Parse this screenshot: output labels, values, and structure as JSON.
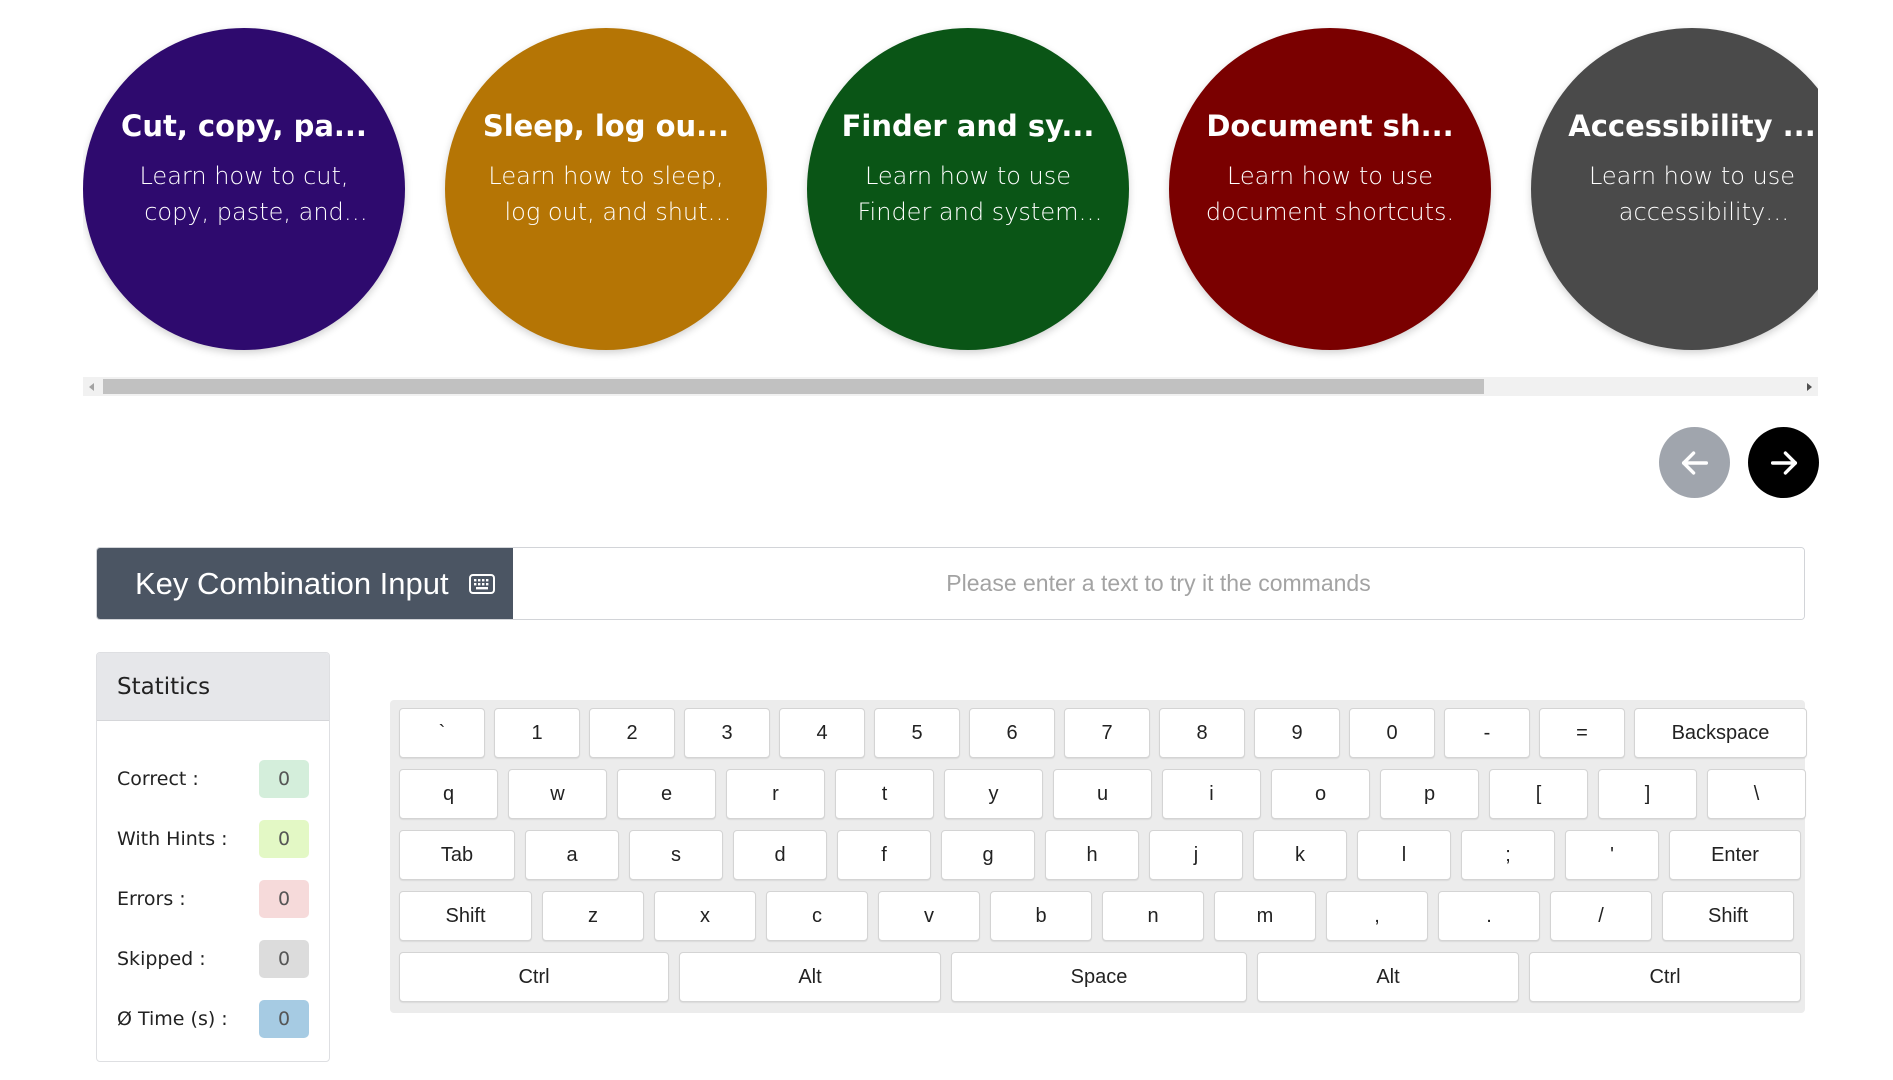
{
  "carousel": {
    "cards": [
      {
        "title": "Cut, copy, pa...",
        "description": "Learn how to cut, copy, paste, and other...",
        "color": "#2e0a6e"
      },
      {
        "title": "Sleep, log ou...",
        "description": "Learn how to sleep, log out, and shut down yo...",
        "color": "#b57505"
      },
      {
        "title": "Finder and sy...",
        "description": "Learn how to use Finder and system shortcuts.",
        "color": "#0a5516"
      },
      {
        "title": "Document sh...",
        "description": "Learn how to use document shortcuts.",
        "color": "#7a0000"
      },
      {
        "title": "Accessibility ...",
        "description": "Learn how to use accessibility shortcuts.",
        "color": "#4a4a4a"
      }
    ],
    "prev_icon": "arrow-left-icon",
    "next_icon": "arrow-right-icon"
  },
  "input": {
    "label": "Key Combination Input",
    "icon": "keyboard-icon",
    "placeholder": "Please enter a text to try it the commands",
    "value": ""
  },
  "stats": {
    "title": "Statitics",
    "rows": [
      {
        "label": "Correct :",
        "value": "0",
        "color": "#d4eedb"
      },
      {
        "label": "With Hints :",
        "value": "0",
        "color": "#e3f8c5"
      },
      {
        "label": "Errors :",
        "value": "0",
        "color": "#f6dada"
      },
      {
        "label": "Skipped :",
        "value": "0",
        "color": "#dcdcdc"
      },
      {
        "label": "Ø Time (s) :",
        "value": "0",
        "color": "#a6cbe3"
      }
    ]
  },
  "keyboard": {
    "rows": [
      [
        "`",
        "1",
        "2",
        "3",
        "4",
        "5",
        "6",
        "7",
        "8",
        "9",
        "0",
        "-",
        "=",
        "Backspace"
      ],
      [
        "q",
        "w",
        "e",
        "r",
        "t",
        "y",
        "u",
        "i",
        "o",
        "p",
        "[",
        "]",
        "\\"
      ],
      [
        "Tab",
        "a",
        "s",
        "d",
        "f",
        "g",
        "h",
        "j",
        "k",
        "l",
        ";",
        "'",
        "Enter"
      ],
      [
        "Shift",
        "z",
        "x",
        "c",
        "v",
        "b",
        "n",
        "m",
        ",",
        ".",
        "/",
        "Shift"
      ],
      [
        "Ctrl",
        "Alt",
        "Space",
        "Alt",
        "Ctrl"
      ]
    ]
  }
}
